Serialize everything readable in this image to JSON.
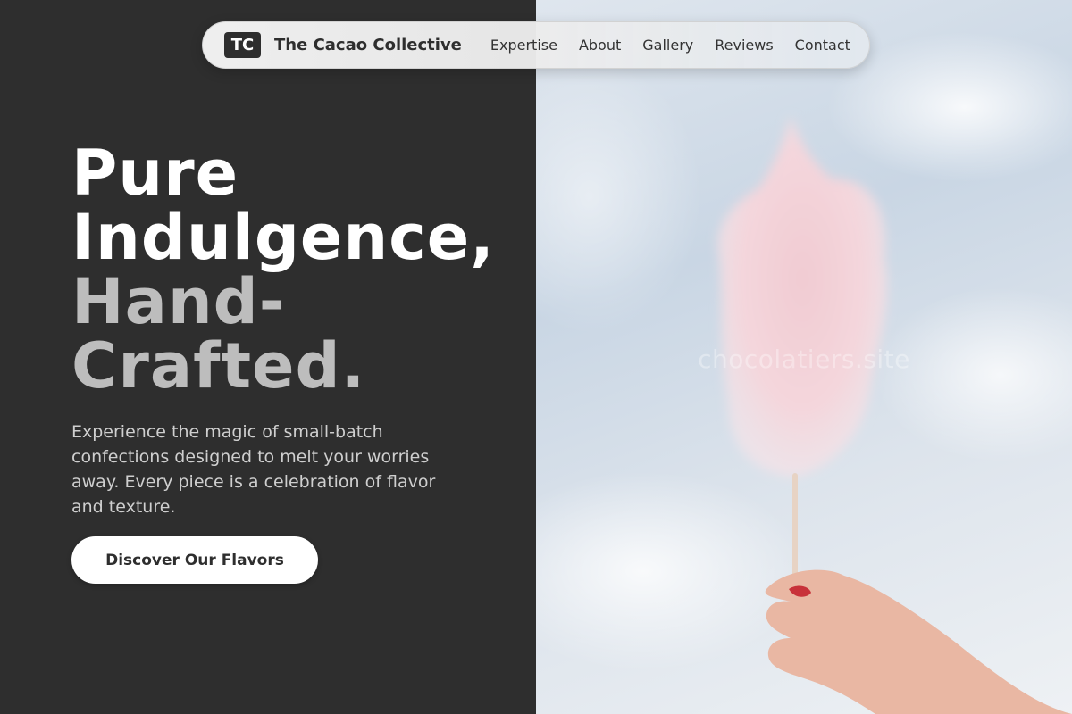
{
  "brand": {
    "logo_text": "TC",
    "name": "The Cacao Collective"
  },
  "nav": {
    "links": [
      {
        "label": "Expertise"
      },
      {
        "label": "About"
      },
      {
        "label": "Gallery"
      },
      {
        "label": "Reviews"
      },
      {
        "label": "Contact"
      }
    ]
  },
  "hero": {
    "headline_line1": "Pure",
    "headline_line2": "Indulgence,",
    "headline_line3": "Hand-",
    "headline_line4": "Crafted.",
    "description": "Experience the magic of small-batch confections designed to melt your worries away. Every piece is a celebration of flavor and texture.",
    "cta_label": "Discover Our Flavors"
  },
  "image": {
    "watermark": "chocolatiers.site"
  },
  "colors": {
    "dark_panel": "#2e2e2e",
    "headline_primary": "#ffffff",
    "headline_secondary": "#bdbdbd",
    "button_bg": "#ffffff"
  }
}
